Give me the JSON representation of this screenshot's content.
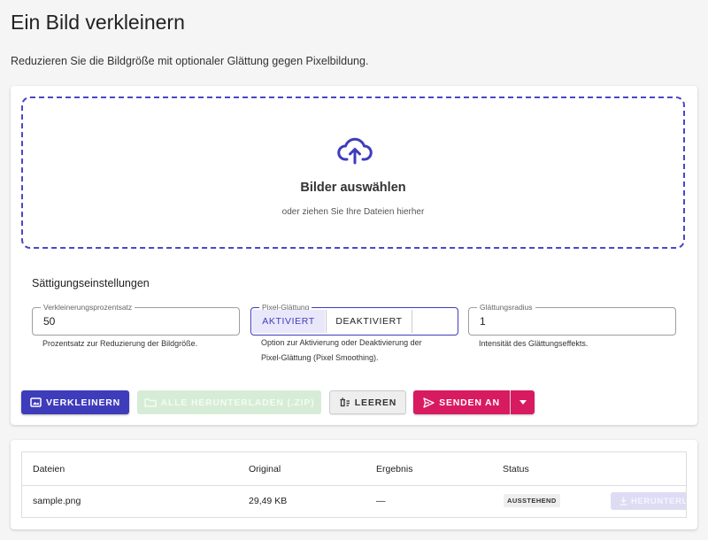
{
  "page": {
    "title": "Ein Bild verkleinern",
    "subtitle": "Reduzieren Sie die Bildgröße mit optionaler Glättung gegen Pixelbildung."
  },
  "dropzone": {
    "icon": "cloud-upload-icon",
    "title": "Bilder auswählen",
    "hint": "oder ziehen Sie Ihre Dateien hierher"
  },
  "settings": {
    "title": "Sättigungseinstellungen",
    "percent": {
      "label": "Verkleinerungsprozentsatz",
      "value": "50",
      "helper": "Prozentsatz zur Reduzierung der Bildgröße."
    },
    "smoothing": {
      "label": "Pixel-Glättung",
      "on_label": "AKTIVIERT",
      "off_label": "DEAKTIVIERT",
      "selected": "AKTIVIERT",
      "helper_line1": "Option zur Aktivierung oder Deaktivierung der",
      "helper_line2": "Pixel-Glättung (Pixel Smoothing)."
    },
    "radius": {
      "label": "Glättungsradius",
      "value": "1",
      "helper": "Intensität des Glättungseffekts."
    }
  },
  "actions": {
    "shrink": "VERKLEINERN",
    "download_all": "ALLE HERUNTERLADEN (.ZIP)",
    "clear": "LEEREN",
    "send_to": "SENDEN AN"
  },
  "table": {
    "headers": [
      "Dateien",
      "Original",
      "Ergebnis",
      "Status"
    ],
    "rows": [
      {
        "file": "sample.png",
        "original": "29,49 KB",
        "result": "—",
        "status": "AUSSTEHEND",
        "download": "HERUNTERLADEN"
      }
    ]
  },
  "colors": {
    "primary": "#3f3cbb",
    "accent": "#d81b60",
    "success_disabled": "#d6ecd6"
  }
}
